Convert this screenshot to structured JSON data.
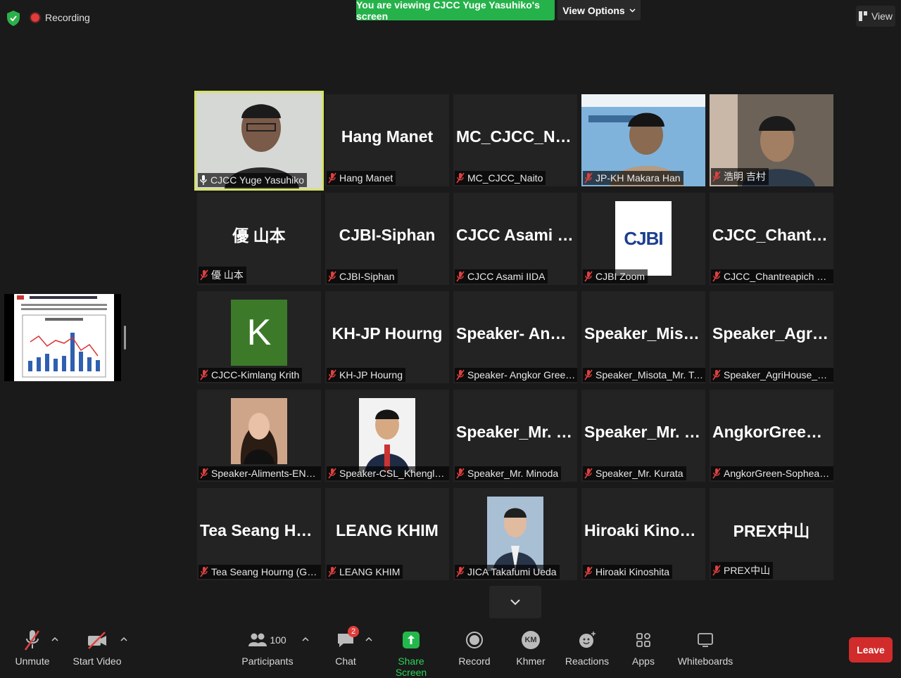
{
  "status": {
    "recording_label": "Recording"
  },
  "banner": {
    "text": "You are viewing CJCC Yuge Yasuhiko's screen",
    "view_options": "View Options"
  },
  "view_button": "View",
  "tiles": [
    {
      "big": "",
      "label": "CJCC Yuge Yasuhiko"
    },
    {
      "big": "Hang Manet",
      "label": "Hang Manet"
    },
    {
      "big": "MC_CJCC_Naito",
      "label": "MC_CJCC_Naito"
    },
    {
      "big": "",
      "label": "JP-KH Makara Han"
    },
    {
      "big": "",
      "label": "浩明 吉村"
    },
    {
      "big": "優 山本",
      "label": "優 山本"
    },
    {
      "big": "CJBI-Siphan",
      "label": "CJBI-Siphan"
    },
    {
      "big": "CJCC Asami IIDA",
      "label": "CJCC Asami IIDA"
    },
    {
      "big": "",
      "label": "CJBI Zoom"
    },
    {
      "big": "CJCC_Chantrea...",
      "label": "CJCC_Chantreapich Vuthy"
    },
    {
      "big": "",
      "label": "CJCC-Kimlang Krith",
      "avatar_letter": "K"
    },
    {
      "big": "KH-JP Hourng",
      "label": "KH-JP Hourng"
    },
    {
      "big": "Speaker-  Angko...",
      "label": "Speaker- Angkor Green _..."
    },
    {
      "big": "Speaker_Misota...",
      "label": "Speaker_Misota_Mr. Tola ..."
    },
    {
      "big": "Speaker_AgriH...",
      "label": "Speaker_AgriHouse_Lund..."
    },
    {
      "big": "",
      "label": "Speaker-Aliments-ENG S..."
    },
    {
      "big": "",
      "label": "Speaker-CSL_Khenglean ..."
    },
    {
      "big": "Speaker_Mr.  Mi...",
      "label": "Speaker_Mr. Minoda"
    },
    {
      "big": "Speaker_Mr.  Ku...",
      "label": "Speaker_Mr. Kurata"
    },
    {
      "big": "AngkorGreen-S...",
      "label": "AngkorGreen-Sopheak C..."
    },
    {
      "big": "Tea  Seang  Hour...",
      "label": "Tea Seang Hourng (Guest)"
    },
    {
      "big": "LEANG KHIM",
      "label": "LEANG KHIM"
    },
    {
      "big": "",
      "label": "JICA Takafumi Ueda"
    },
    {
      "big": "Hiroaki Kinoshita",
      "label": "Hiroaki Kinoshita"
    },
    {
      "big": "PREX中山",
      "label": "PREX中山"
    }
  ],
  "cjbi_logo_text": "CJBI",
  "toolbar": {
    "unmute": "Unmute",
    "start_video": "Start Video",
    "participants": "Participants",
    "participant_count": "100",
    "chat": "Chat",
    "chat_badge": "2",
    "share_screen": "Share Screen",
    "record": "Record",
    "khmer": "Khmer",
    "khmer_initials": "KM",
    "reactions": "Reactions",
    "apps": "Apps",
    "whiteboards": "Whiteboards",
    "leave": "Leave"
  },
  "colors": {
    "banner_green": "#26b24a",
    "active_border": "#d6e36a",
    "leave_red": "#d22b2b",
    "muted_red": "#e04040"
  }
}
